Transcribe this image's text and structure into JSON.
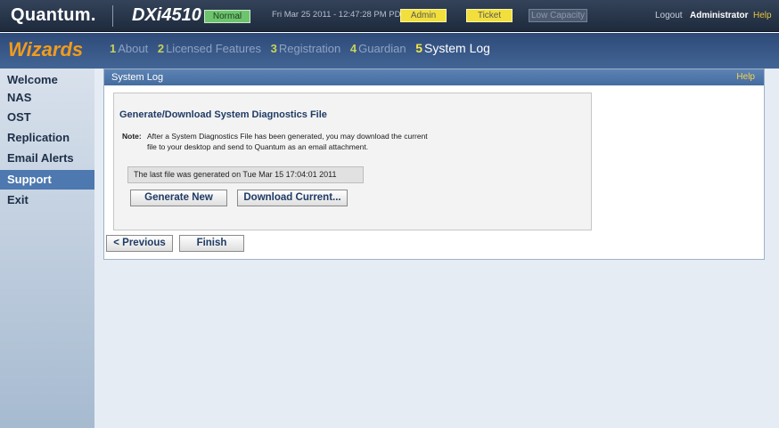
{
  "header": {
    "logo": "Quantum.",
    "product": "DXi4510",
    "status_badge": "Normal",
    "datetime": "Fri Mar 25 2011 - 12:47:28 PM PDT",
    "admin_badge": "Admin",
    "ticket_badge": "Ticket",
    "low_capacity_badge": "Low Capacity",
    "logout": "Logout",
    "user": "Administrator",
    "help": "Help"
  },
  "wizard": {
    "title": "Wizards",
    "steps": [
      {
        "num": "1",
        "label": "About"
      },
      {
        "num": "2",
        "label": "Licensed Features"
      },
      {
        "num": "3",
        "label": "Registration"
      },
      {
        "num": "4",
        "label": "Guardian"
      },
      {
        "num": "5",
        "label": "System Log"
      }
    ],
    "active_step": 5
  },
  "sidebar": {
    "items": [
      {
        "label": "Welcome"
      },
      {
        "label": "NAS"
      },
      {
        "label": "OST"
      },
      {
        "label": "Replication"
      },
      {
        "label": "Email Alerts"
      },
      {
        "label": "Support"
      },
      {
        "label": "Exit"
      }
    ],
    "active": "Support"
  },
  "panel": {
    "title": "System Log",
    "help": "Help",
    "section_title": "Generate/Download System Diagnostics File",
    "note_label": "Note:",
    "note_line1": "After a System Diagnostics File has been generated, you may download the current",
    "note_line2": "file to your desktop and send to Quantum as an email attachment.",
    "last_file": "The last file was generated on Tue Mar 15 17:04:01 2011",
    "generate_button": "Generate New",
    "download_button": "Download Current...",
    "previous_button": "< Previous",
    "finish_button": "Finish"
  },
  "colors": {
    "header_bg": "#2a3850",
    "wizard_bg": "#36598a",
    "wizard_title": "#f29b1c",
    "nav_active": "#4d78b0",
    "panel_header": "#5079ac",
    "badge_normal": "#6ec46e",
    "badge_yellow": "#f2df3c"
  }
}
